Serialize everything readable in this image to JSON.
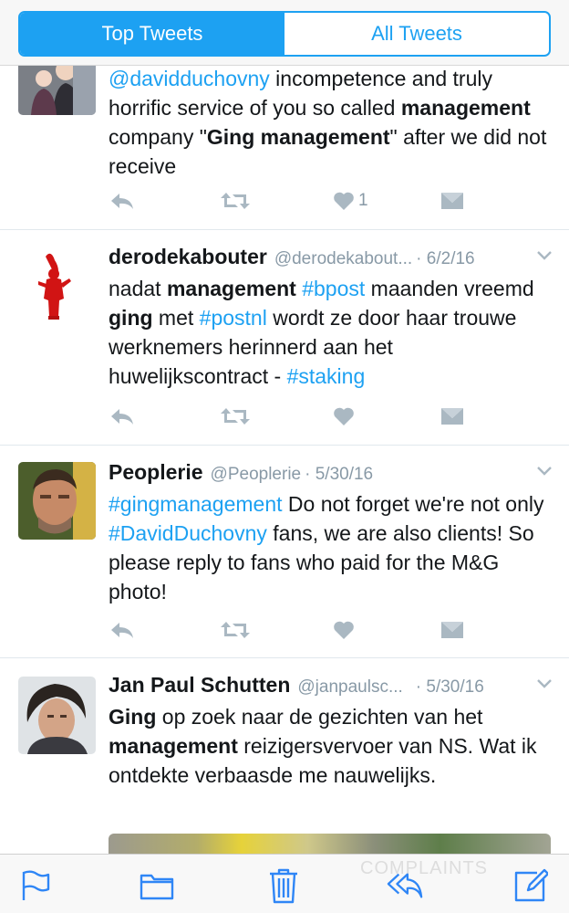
{
  "tabs": {
    "top": "Top Tweets",
    "all": "All Tweets"
  },
  "tweets": [
    {
      "name": "",
      "handle": "",
      "date": "",
      "likes": "1",
      "body": [
        {
          "t": "@davidduchovny",
          "k": "tag"
        },
        {
          "t": " incompetence and truly horrific service of you so called ",
          "k": ""
        },
        {
          "t": "management",
          "k": "b"
        },
        {
          "t": " company \"",
          "k": ""
        },
        {
          "t": "Ging management",
          "k": "b"
        },
        {
          "t": "\" after we did not receive",
          "k": ""
        }
      ]
    },
    {
      "name": "derodekabouter",
      "handle": "@derodekabout...",
      "date": "· 6/2/16",
      "likes": "",
      "body": [
        {
          "t": "nadat ",
          "k": ""
        },
        {
          "t": "management",
          "k": "b"
        },
        {
          "t": " ",
          "k": ""
        },
        {
          "t": "#bpost",
          "k": "tag"
        },
        {
          "t": " maanden vreemd ",
          "k": ""
        },
        {
          "t": "ging",
          "k": "b"
        },
        {
          "t": " met ",
          "k": ""
        },
        {
          "t": "#postnl",
          "k": "tag"
        },
        {
          "t": " wordt ze door haar trouwe werknemers herinnerd aan het huwelijkscontract - ",
          "k": ""
        },
        {
          "t": "#staking",
          "k": "tag"
        }
      ]
    },
    {
      "name": "Peoplerie",
      "handle": "@Peoplerie",
      "date": "· 5/30/16",
      "likes": "",
      "body": [
        {
          "t": "#gingmanagement",
          "k": "tag"
        },
        {
          "t": " Do not forget we're not only ",
          "k": ""
        },
        {
          "t": "#DavidDuchovny",
          "k": "tag"
        },
        {
          "t": " fans, we are also clients! So please reply to fans who paid for the M&G photo!",
          "k": ""
        }
      ]
    },
    {
      "name": "Jan Paul Schutten",
      "handle": "@janpaulsc...",
      "date": "· 5/30/16",
      "likes": "",
      "body": [
        {
          "t": "Ging",
          "k": "b"
        },
        {
          "t": " op zoek naar de gezichten van het ",
          "k": ""
        },
        {
          "t": "management",
          "k": "b"
        },
        {
          "t": " reizigersvervoer van NS. Wat ik ontdekte verbaasde me nauwelijks.",
          "k": ""
        }
      ]
    }
  ],
  "toolbar": {
    "icons": [
      "flag-icon",
      "folder-icon",
      "trash-icon",
      "reply-all-icon",
      "compose-icon"
    ]
  },
  "watermark": "COMPLAINTS"
}
